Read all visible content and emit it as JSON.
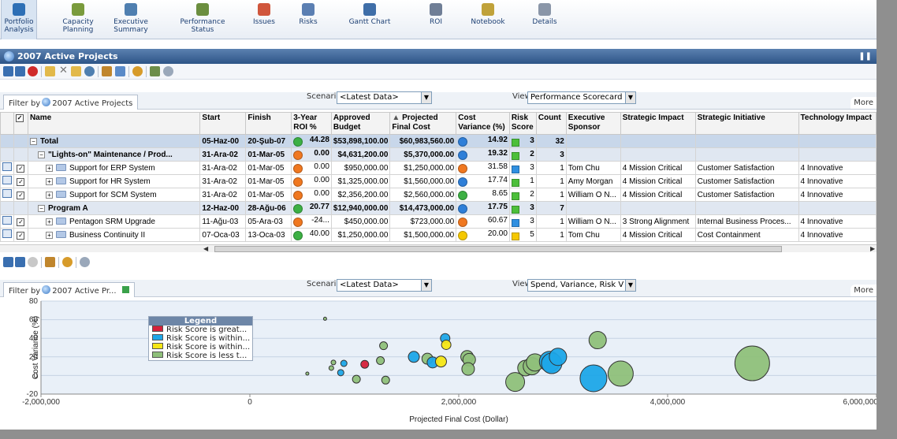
{
  "nav": [
    {
      "line1": "Portfolio",
      "line2": "Analysis",
      "color": "#2d6fb5"
    },
    {
      "line1": "Capacity",
      "line2": "Planning",
      "color": "#7a9b3c"
    },
    {
      "line1": "Executive",
      "line2": "Summary",
      "color": "#4f7fb0"
    },
    {
      "line1": "Performance",
      "line2": "Status",
      "color": "#6b8e3f"
    },
    {
      "line1": "Issues",
      "line2": "",
      "color": "#d0563c"
    },
    {
      "line1": "Risks",
      "line2": "",
      "color": "#5b7fb2"
    },
    {
      "line1": "Gantt Chart",
      "line2": "",
      "color": "#3f6ea8"
    },
    {
      "line1": "ROI",
      "line2": "",
      "color": "#6f7e96"
    },
    {
      "line1": "Notebook",
      "line2": "",
      "color": "#c0a23a"
    },
    {
      "line1": "Details",
      "line2": "",
      "color": "#8a96a8"
    }
  ],
  "main": {
    "title": "2007 Active Projects",
    "filter_prefix": "Filter by",
    "filter_name": "2007 Active Projects",
    "scenario_label": "Scenario",
    "scenario_value": "<Latest Data>",
    "view_label": "View",
    "view_value": "Performance Scorecard",
    "more": "More"
  },
  "grid": {
    "headers": [
      "Name",
      "Start",
      "Finish",
      "3-Year ROI %",
      "Approved Budget",
      "Projected Final Cost",
      "Cost Variance (%)",
      "Risk Score",
      "Count",
      "Executive Sponsor",
      "Strategic Impact",
      "Strategic Initiative",
      "Technology Impact"
    ],
    "rows": [
      {
        "type": "total",
        "name": "Total",
        "start": "05-Haz-00",
        "finish": "20-Şub-07",
        "roi_color": "#3cb043",
        "roi": "44.28",
        "budget": "$53,898,100.00",
        "cost": "$60,983,560.00",
        "cv_color": "#2f7fd8",
        "cv": "14.92",
        "risk_color": "#4cbf3a",
        "risk": "3",
        "count": "32",
        "sponsor": "",
        "impact": "",
        "initiative": "",
        "tech": ""
      },
      {
        "type": "group",
        "name": "\"Lights-on\" Maintenance / Prod...",
        "start": "31-Ara-02",
        "finish": "01-Mar-05",
        "roi_color": "#f07820",
        "roi": "0.00",
        "budget": "$4,631,200.00",
        "cost": "$5,370,000.00",
        "cv_color": "#2f7fd8",
        "cv": "19.32",
        "risk_color": "#4cbf3a",
        "risk": "2",
        "count": "3",
        "sponsor": "",
        "impact": "",
        "initiative": "",
        "tech": ""
      },
      {
        "type": "item",
        "name": "Support for ERP System",
        "start": "31-Ara-02",
        "finish": "01-Mar-05",
        "roi_color": "#f07820",
        "roi": "0.00",
        "budget": "$950,000.00",
        "cost": "$1,250,000.00",
        "cv_color": "#f07820",
        "cv": "31.58",
        "risk_color": "#2f8fe0",
        "risk": "3",
        "count": "1",
        "sponsor": "Tom Chu",
        "impact": "4 Mission Critical",
        "initiative": "Customer Satisfaction",
        "tech": "4 Innovative"
      },
      {
        "type": "item",
        "name": "Support for HR System",
        "start": "31-Ara-02",
        "finish": "01-Mar-05",
        "roi_color": "#f07820",
        "roi": "0.00",
        "budget": "$1,325,000.00",
        "cost": "$1,560,000.00",
        "cv_color": "#2f7fd8",
        "cv": "17.74",
        "risk_color": "#4cbf3a",
        "risk": "1",
        "count": "1",
        "sponsor": "Amy Morgan",
        "impact": "4 Mission Critical",
        "initiative": "Customer Satisfaction",
        "tech": "4 Innovative"
      },
      {
        "type": "item",
        "name": "Support for SCM System",
        "start": "31-Ara-02",
        "finish": "01-Mar-05",
        "roi_color": "#f07820",
        "roi": "0.00",
        "budget": "$2,356,200.00",
        "cost": "$2,560,000.00",
        "cv_color": "#3cb043",
        "cv": "8.65",
        "risk_color": "#4cbf3a",
        "risk": "2",
        "count": "1",
        "sponsor": "William O N...",
        "impact": "4 Mission Critical",
        "initiative": "Customer Satisfaction",
        "tech": "4 Innovative"
      },
      {
        "type": "group",
        "name": "Program A",
        "start": "12-Haz-00",
        "finish": "28-Ağu-06",
        "roi_color": "#3cb043",
        "roi": "20.77",
        "budget": "$12,940,000.00",
        "cost": "$14,473,000.00",
        "cv_color": "#2f7fd8",
        "cv": "17.75",
        "risk_color": "#4cbf3a",
        "risk": "3",
        "count": "7",
        "sponsor": "",
        "impact": "",
        "initiative": "",
        "tech": ""
      },
      {
        "type": "item",
        "name": "Pentagon SRM Upgrade",
        "start": "11-Ağu-03",
        "finish": "05-Ara-03",
        "roi_color": "#f07820",
        "roi": "-24...",
        "budget": "$450,000.00",
        "cost": "$723,000.00",
        "cv_color": "#f07820",
        "cv": "60.67",
        "risk_color": "#2f8fe0",
        "risk": "3",
        "count": "1",
        "sponsor": "William O N...",
        "impact": "3 Strong Alignment",
        "initiative": "Internal Business Proces...",
        "tech": "4 Innovative"
      },
      {
        "type": "item",
        "name": "Business Continuity II",
        "start": "07-Oca-03",
        "finish": "13-Oca-03",
        "roi_color": "#3cb043",
        "roi": "40.00",
        "budget": "$1,250,000.00",
        "cost": "$1,500,000.00",
        "cv_color": "#f5c800",
        "cv": "20.00",
        "risk_color": "#f5c800",
        "risk": "5",
        "count": "1",
        "sponsor": "Tom Chu",
        "impact": "4 Mission Critical",
        "initiative": "Cost Containment",
        "tech": "4 Innovative"
      }
    ]
  },
  "bottom": {
    "filter_prefix": "Filter by",
    "filter_name": "2007 Active Pr...",
    "scenario_label": "Scenario",
    "scenario_value": "<Latest Data>",
    "view_label": "View",
    "view_value": "Spend, Variance, Risk V",
    "more": "More"
  },
  "legend": {
    "title": "Legend",
    "items": [
      {
        "label": "Risk Score is great...",
        "color": "#d6203a"
      },
      {
        "label": "Risk Score is within...",
        "color": "#1ea6e8"
      },
      {
        "label": "Risk Score is within...",
        "color": "#f5e615"
      },
      {
        "label": "Risk Score is less t...",
        "color": "#8fc07a"
      }
    ]
  },
  "chart_data": {
    "type": "scatter",
    "xlabel": "Projected Final Cost (Dollar)",
    "ylabel": "Cost Variance (%)",
    "xlim": [
      -2000000,
      6000000
    ],
    "ylim": [
      -20,
      80
    ],
    "x_ticks": [
      "-2,000,000",
      "0",
      "2,000,000",
      "4,000,000",
      "6,000,000"
    ],
    "x_tick_values": [
      -2000000,
      0,
      2000000,
      4000000,
      6000000
    ],
    "y_ticks": [
      "80",
      "60",
      "40",
      "20",
      "0",
      "-20"
    ],
    "y_tick_values": [
      80,
      60,
      40,
      20,
      0,
      -20
    ],
    "points": [
      {
        "x": 720000,
        "y": 61,
        "r": 2,
        "c": "#8fc07a"
      },
      {
        "x": 550000,
        "y": 2,
        "r": 2,
        "c": "#8fc07a"
      },
      {
        "x": 780000,
        "y": 8,
        "r": 3,
        "c": "#8fc07a"
      },
      {
        "x": 800000,
        "y": 14,
        "r": 3,
        "c": "#8fc07a"
      },
      {
        "x": 870000,
        "y": 3,
        "r": 4,
        "c": "#1ea6e8"
      },
      {
        "x": 900000,
        "y": 13,
        "r": 4,
        "c": "#1ea6e8"
      },
      {
        "x": 1020000,
        "y": -4,
        "r": 5,
        "c": "#8fc07a"
      },
      {
        "x": 1100000,
        "y": 12,
        "r": 5,
        "c": "#d6203a"
      },
      {
        "x": 1250000,
        "y": 16,
        "r": 5,
        "c": "#8fc07a"
      },
      {
        "x": 1280000,
        "y": 32,
        "r": 5,
        "c": "#8fc07a"
      },
      {
        "x": 1300000,
        "y": -5,
        "r": 5,
        "c": "#8fc07a"
      },
      {
        "x": 1570000,
        "y": 20,
        "r": 7,
        "c": "#1ea6e8"
      },
      {
        "x": 1700000,
        "y": 18,
        "r": 7,
        "c": "#8fc07a"
      },
      {
        "x": 1750000,
        "y": 14,
        "r": 7,
        "c": "#1ea6e8"
      },
      {
        "x": 1830000,
        "y": 15,
        "r": 7,
        "c": "#f5e615"
      },
      {
        "x": 1870000,
        "y": 40,
        "r": 6,
        "c": "#1ea6e8"
      },
      {
        "x": 1880000,
        "y": 33,
        "r": 6,
        "c": "#f5e615"
      },
      {
        "x": 2080000,
        "y": 20,
        "r": 8,
        "c": "#8fc07a"
      },
      {
        "x": 2100000,
        "y": 17,
        "r": 8,
        "c": "#8fc07a"
      },
      {
        "x": 2090000,
        "y": 7,
        "r": 8,
        "c": "#8fc07a"
      },
      {
        "x": 2540000,
        "y": -7,
        "r": 12,
        "c": "#8fc07a"
      },
      {
        "x": 2640000,
        "y": 8,
        "r": 10,
        "c": "#8fc07a"
      },
      {
        "x": 2700000,
        "y": 10,
        "r": 11,
        "c": "#8fc07a"
      },
      {
        "x": 2730000,
        "y": 14,
        "r": 11,
        "c": "#8fc07a"
      },
      {
        "x": 2870000,
        "y": 15,
        "r": 13,
        "c": "#1ea6e8"
      },
      {
        "x": 2890000,
        "y": 13,
        "r": 13,
        "c": "#1ea6e8"
      },
      {
        "x": 2950000,
        "y": 20,
        "r": 11,
        "c": "#1ea6e8"
      },
      {
        "x": 3290000,
        "y": -3,
        "r": 17,
        "c": "#1ea6e8"
      },
      {
        "x": 3330000,
        "y": 38,
        "r": 11,
        "c": "#8fc07a"
      },
      {
        "x": 3550000,
        "y": 2,
        "r": 16,
        "c": "#8fc07a"
      },
      {
        "x": 4810000,
        "y": 13,
        "r": 22,
        "c": "#8fc07a"
      }
    ]
  }
}
